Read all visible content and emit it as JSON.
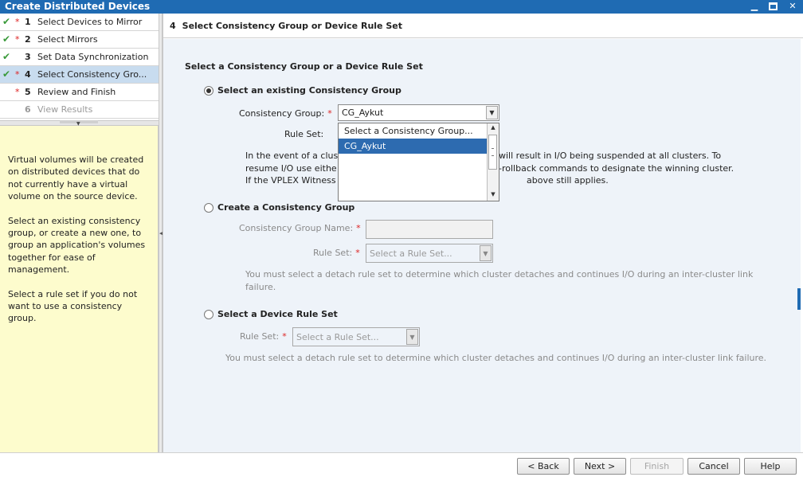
{
  "window": {
    "title": "Create Distributed Devices",
    "minimize": "▁",
    "close": "✕"
  },
  "steps": [
    {
      "num": "1",
      "label": "Select Devices to Mirror",
      "check": "✔",
      "req": "*"
    },
    {
      "num": "2",
      "label": "Select Mirrors",
      "check": "✔",
      "req": "*"
    },
    {
      "num": "3",
      "label": "Set Data Synchronization",
      "check": "✔",
      "req": ""
    },
    {
      "num": "4",
      "label": "Select Consistency Gro...",
      "check": "✔",
      "req": "*"
    },
    {
      "num": "5",
      "label": "Review and Finish",
      "check": "",
      "req": "*"
    },
    {
      "num": "6",
      "label": "View Results",
      "check": "",
      "req": ""
    }
  ],
  "help": {
    "p1": "Virtual volumes will be created on distributed devices that do not currently have a virtual volume on the source device.",
    "p2": "Select an existing consistency group, or create a new one, to group an application's volumes together for ease of management.",
    "p3": "Select a rule set if you do not want to use a consistency group."
  },
  "page": {
    "step_number": "4",
    "title": "Select Consistency Group or Device Rule Set"
  },
  "form": {
    "section_title": "Select a Consistency Group or a Device Rule Set",
    "existing": {
      "radio_label": "Select an existing Consistency Group",
      "cg_label": "Consistency Group:",
      "cg_value": "CG_Aykut",
      "rule_label": "Rule Set:",
      "note_line1_a": "In the event of a clus",
      "note_line1_b": "will result in I/O being suspended at all clusters. To",
      "note_line2_a": "resume I/O use eithe",
      "note_line2_b": "-rollback commands to designate the winning cluster.",
      "note_line3_a": "If the VPLEX Witness",
      "note_line3_b": "above still applies."
    },
    "create": {
      "radio_label": "Create a Consistency Group",
      "name_label": "Consistency Group Name:",
      "rule_label": "Rule Set:",
      "rule_placeholder": "Select a Rule Set...",
      "note": "You must select a detach rule set to determine which cluster detaches and continues I/O during an inter-cluster link failure."
    },
    "device": {
      "radio_label": "Select a Device Rule Set",
      "rule_label": "Rule Set:",
      "rule_placeholder": "Select a Rule Set...",
      "note": "You must select a detach rule set to determine which cluster detaches and continues I/O during an inter-cluster link failure."
    },
    "required_star": "*"
  },
  "dropdown": {
    "options": [
      "Select a Consistency Group...",
      "CG_Aykut"
    ],
    "selected_index": 1
  },
  "footer": {
    "back": "< Back",
    "next": "Next >",
    "finish": "Finish",
    "cancel": "Cancel",
    "help": "Help"
  }
}
